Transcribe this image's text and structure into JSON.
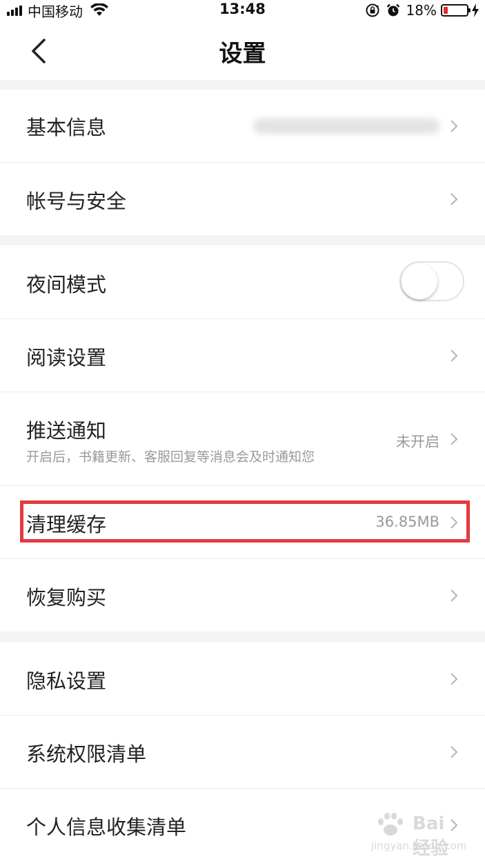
{
  "status_bar": {
    "carrier": "中国移动",
    "time": "13:48",
    "battery_percent": "18%",
    "battery_level": 0.18,
    "icons": [
      "signal-icon",
      "wifi-icon",
      "rotation-lock-icon",
      "alarm-icon",
      "battery-icon",
      "charging-icon"
    ]
  },
  "header": {
    "title": "设置",
    "back_icon": "chevron-left-icon"
  },
  "groups": [
    {
      "items": [
        {
          "label": "基本信息",
          "value": "",
          "value_obscured": true,
          "control": "chevron"
        },
        {
          "label": "帐号与安全",
          "value": "",
          "control": "chevron"
        }
      ]
    },
    {
      "items": [
        {
          "label": "夜间模式",
          "control": "toggle",
          "toggle_on": false
        },
        {
          "label": "阅读设置",
          "control": "chevron"
        },
        {
          "label": "推送通知",
          "sublabel": "开启后，书籍更新、客服回复等消息会及时通知您",
          "value": "未开启",
          "control": "chevron"
        },
        {
          "label": "清理缓存",
          "value": "36.85MB",
          "control": "chevron",
          "highlighted": true
        },
        {
          "label": "恢复购买",
          "control": "chevron"
        }
      ]
    },
    {
      "items": [
        {
          "label": "隐私设置",
          "control": "chevron"
        },
        {
          "label": "系统权限清单",
          "control": "chevron"
        },
        {
          "label": "个人信息收集清单",
          "control": "chevron"
        }
      ]
    }
  ],
  "watermark": {
    "text": "Bai 经验",
    "sub": "jingyan.baidu.com"
  },
  "colors": {
    "highlight": "#e33a3f",
    "battery_low": "#e8282b",
    "section_gap": "#f4f4f4",
    "secondary_text": "#999999"
  }
}
